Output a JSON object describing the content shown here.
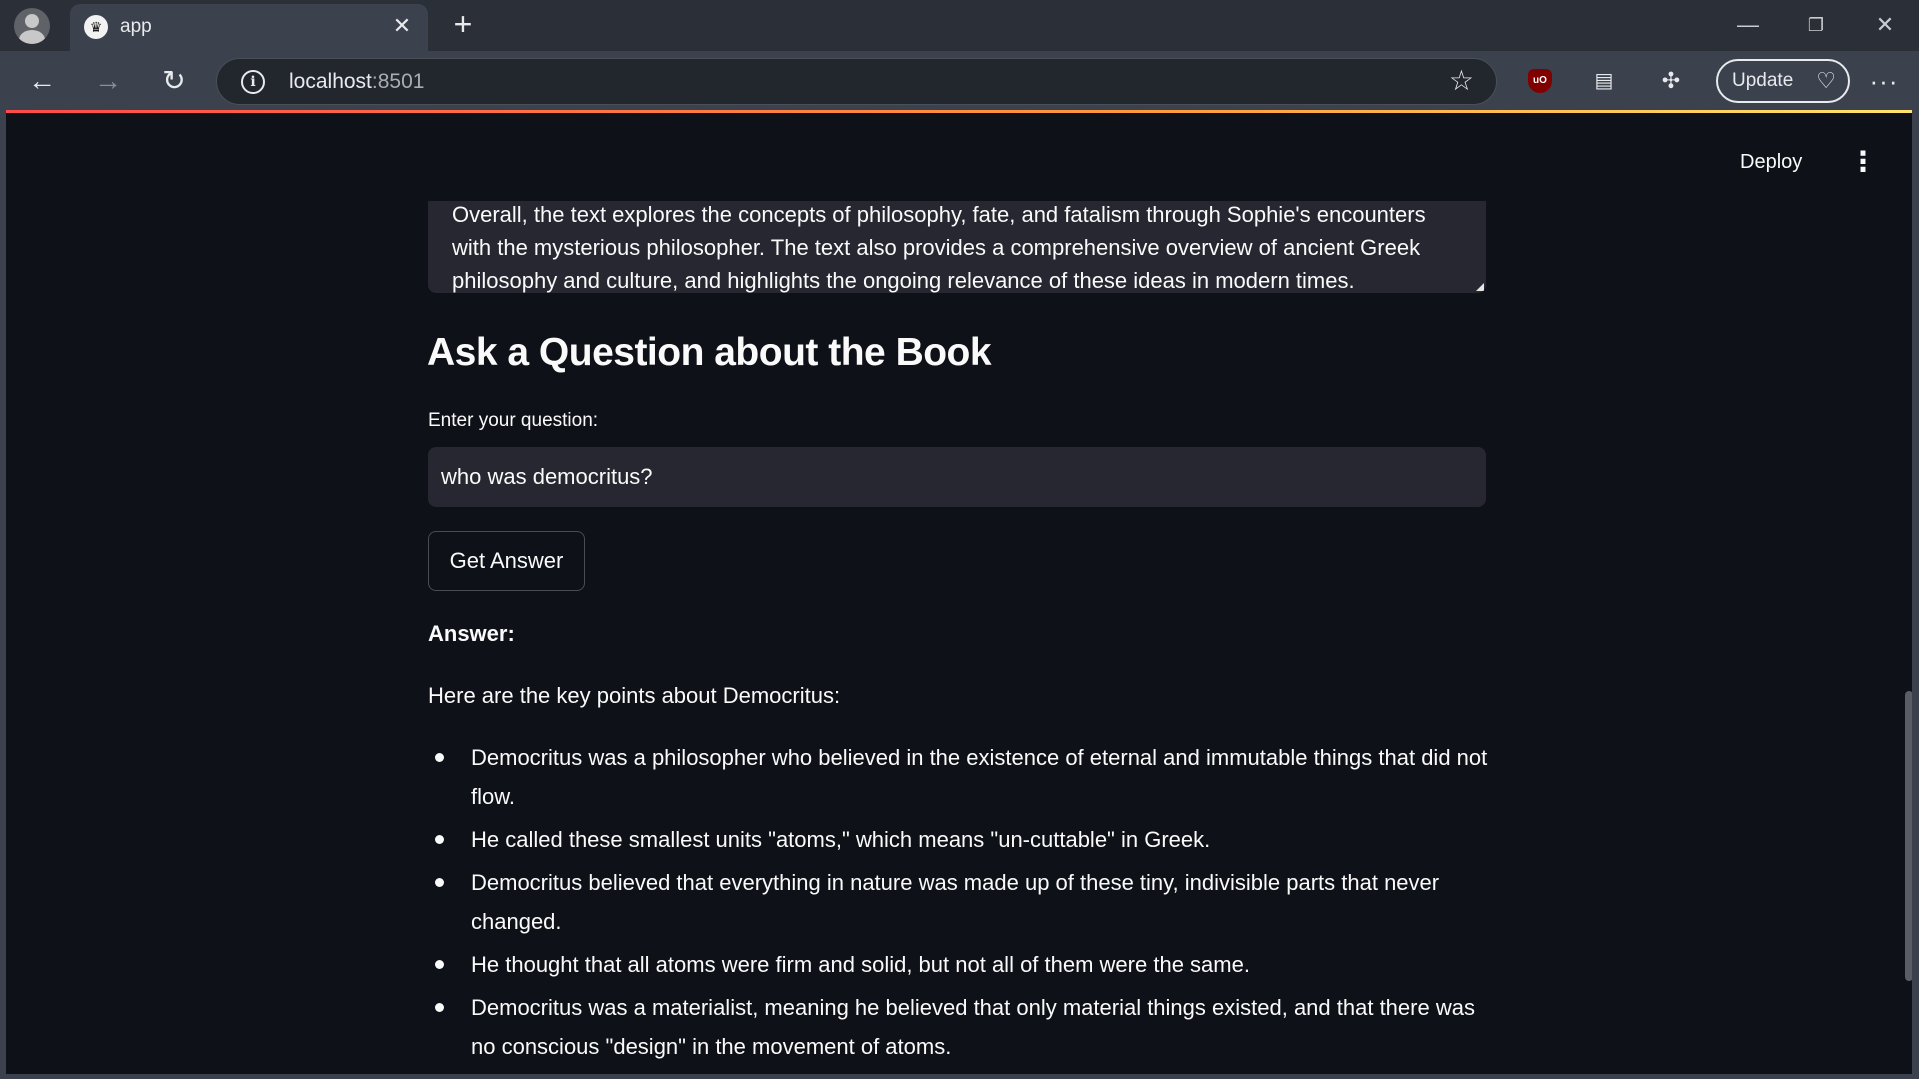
{
  "browser": {
    "tab_title": "app",
    "tab_favicon": "streamlit-crown-icon",
    "url_host": "localhost",
    "url_port": ":8501",
    "update_label": "Update",
    "icons": {
      "back": "back-arrow-icon",
      "forward": "forward-arrow-icon",
      "reload": "reload-icon",
      "info": "site-info-icon",
      "bookmark": "star-icon",
      "extensions": [
        "ublock-origin-icon",
        "media-icon",
        "puzzle-extensions-icon"
      ],
      "menu": "more-menu-icon"
    }
  },
  "app": {
    "deploy_label": "Deploy",
    "summary": {
      "line1": "Overall, the text explores the concepts of philosophy, fate, and fatalism through Sophie's encounters",
      "line2": "with the mysterious philosopher. The text also provides a comprehensive overview of ancient Greek",
      "line3_a": "philosophy and ",
      "line3_underlined": "culture, and",
      "line3_b": " highlights the ongoing relevance of these ideas in modern times."
    },
    "heading": "Ask a Question about the Book",
    "question_label": "Enter your question:",
    "question_value": "who was democritus?",
    "button_label": "Get Answer",
    "answer_label": "Answer:",
    "answer_intro": "Here are the key points about Democritus:",
    "points": [
      "Democritus was a philosopher who believed in the existence of eternal and immutable things that did not flow.",
      "He called these smallest units \"atoms,\" which means \"un-cuttable\" in Greek.",
      "Democritus believed that everything in nature was made up of these tiny, indivisible parts that never changed.",
      "He thought that all atoms were firm and solid, but not all of them were the same.",
      "Democritus was a materialist, meaning he believed that only material things existed, and that there was no conscious \"design\" in the movement of atoms."
    ]
  },
  "colors": {
    "app_bg": "#0e1117",
    "widget_bg": "#262730",
    "text": "#fafafa",
    "accent_gradient": [
      "#ff4b4b",
      "#ffe36e"
    ]
  }
}
